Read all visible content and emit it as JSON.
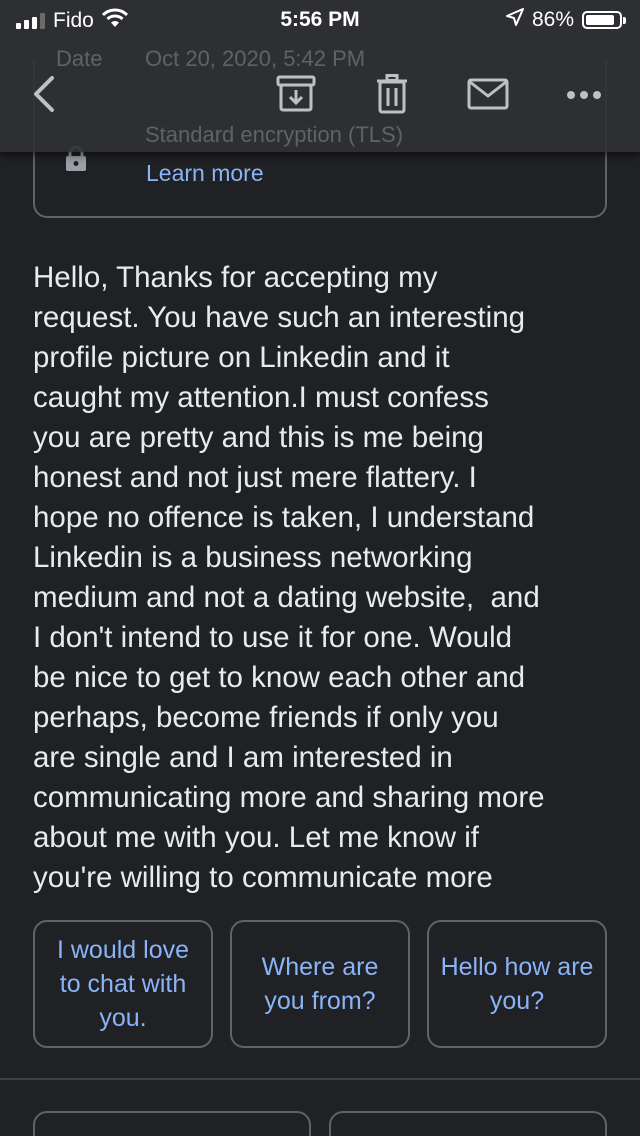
{
  "status_bar": {
    "carrier": "Fido",
    "time": "5:56 PM",
    "battery": "86%",
    "battery_level": 0.86
  },
  "toolbar": {
    "back_icon": "chevron-left-icon",
    "archive_icon": "archive-icon",
    "delete_icon": "trash-icon",
    "mark_unread_icon": "mail-icon",
    "more_icon": "more-horizontal-icon"
  },
  "details": {
    "date_label": "Date",
    "date_value": "Oct 20, 2020, 5:42 PM",
    "encryption": "Standard encryption (TLS)",
    "learn_more": "Learn more"
  },
  "message": {
    "body": "Hello, Thanks for accepting my\nrequest. You have such an interesting\nprofile picture on Linkedin and it\ncaught my attention.I must confess\nyou are pretty and this is me being\nhonest and not just mere flattery. I\nhope no offence is taken, I understand\nLinkedin is a business networking\nmedium and not a dating website,  and\nI don't intend to use it for one. Would\nbe nice to get to know each other and\nperhaps, become friends if only you\nare single and I am interested in\ncommunicating more and sharing more\nabout me with you. Let me know if\nyou're willing to communicate more"
  },
  "smart_replies": [
    {
      "label": "I would love to chat with you."
    },
    {
      "label": "Where are you from?"
    },
    {
      "label": "Hello how are you?"
    }
  ],
  "colors": {
    "background": "#202124",
    "accent": "#8ab4f8",
    "border": "#5f6368",
    "text": "#e8eaed"
  }
}
